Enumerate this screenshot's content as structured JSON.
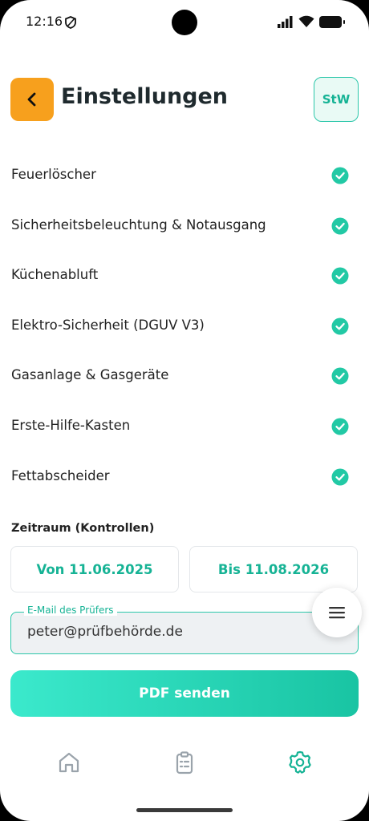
{
  "status_bar": {
    "time": "12:16",
    "icons": [
      "shield-icon",
      "signal-icon",
      "wifi-icon",
      "battery-icon"
    ]
  },
  "header": {
    "title": "Einstellungen",
    "back_icon": "chevron-left-icon",
    "avatar_text": "StW"
  },
  "colors": {
    "accent": "#16b395",
    "back_button": "#f7a01d",
    "gradient_start": "#3be9cc",
    "gradient_end": "#19c4a3"
  },
  "checks": {
    "items": [
      {
        "label": "Feuerlöscher",
        "checked": true
      },
      {
        "label": "Sicherheitsbeleuchtung & Notausgang",
        "checked": true
      },
      {
        "label": "Küchenabluft",
        "checked": true
      },
      {
        "label": "Elektro-Sicherheit (DGUV V3)",
        "checked": true
      },
      {
        "label": "Gasanlage & Gasgeräte",
        "checked": true
      },
      {
        "label": "Erste-Hilfe-Kasten",
        "checked": true
      },
      {
        "label": "Fettabscheider",
        "checked": true
      }
    ]
  },
  "period": {
    "label": "Zeitraum (Kontrollen)",
    "from": "Von 11.06.2025",
    "to": "Bis 11.08.2026"
  },
  "email": {
    "legend": "E-Mail des Prüfers",
    "value": "peter@prüfbehörde.de"
  },
  "actions": {
    "pdf_send": "PDF senden"
  },
  "bottom_nav": {
    "items": [
      "home-icon",
      "clipboard-icon",
      "settings-icon"
    ],
    "active": "settings-icon"
  }
}
